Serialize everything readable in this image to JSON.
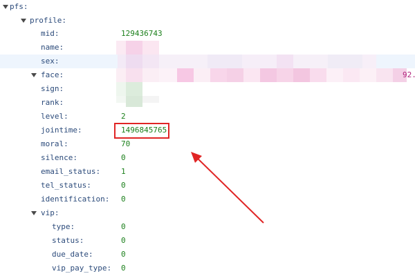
{
  "tree": {
    "pfs_key": "pfs:",
    "profile_key": "profile:",
    "mid_key": "mid:",
    "mid_value": "129436743",
    "name_key": "name:",
    "sex_key": "sex:",
    "face_key": "face:",
    "face_tail": "92.",
    "sign_key": "sign:",
    "rank_key": "rank:",
    "level_key": "level:",
    "level_value": "2",
    "jointime_key": "jointime:",
    "jointime_value": "1496845765",
    "moral_key": "moral:",
    "moral_value": "70",
    "silence_key": "silence:",
    "silence_value": "0",
    "email_status_key": "email_status:",
    "email_status_value": "1",
    "tel_status_key": "tel_status:",
    "tel_status_value": "0",
    "identification_key": "identification:",
    "identification_value": "0",
    "vip_key": "vip:",
    "type_key": "type:",
    "type_value": "0",
    "status_key": "status:",
    "status_value": "0",
    "due_date_key": "due_date:",
    "due_date_value": "0",
    "vip_pay_type_key": "vip_pay_type:",
    "vip_pay_type_value": "0"
  },
  "colors": {
    "key": "#2b4a7a",
    "value": "#1a7f1a",
    "highlight_row": "#eef5fd",
    "annotation": "#e02424"
  }
}
